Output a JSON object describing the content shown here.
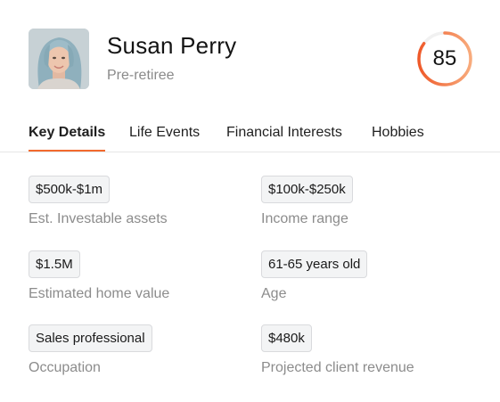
{
  "profile": {
    "name": "Susan Perry",
    "persona": "Pre-retiree",
    "score": "85",
    "score_fraction": 0.85,
    "accent_color": "#f26a2e"
  },
  "tabs": [
    {
      "label": "Key Details",
      "active": true
    },
    {
      "label": "Life Events",
      "active": false
    },
    {
      "label": "Financial Interests",
      "active": false
    },
    {
      "label": "Hobbies",
      "active": false
    }
  ],
  "details": [
    {
      "value": "$500k-$1m",
      "label": "Est. Investable assets"
    },
    {
      "value": "$100k-$250k",
      "label": "Income range"
    },
    {
      "value": "$1.5M",
      "label": "Estimated home value"
    },
    {
      "value": "61-65 years old",
      "label": "Age"
    },
    {
      "value": "Sales professional",
      "label": "Occupation"
    },
    {
      "value": "$480k",
      "label": "Projected client revenue"
    }
  ]
}
